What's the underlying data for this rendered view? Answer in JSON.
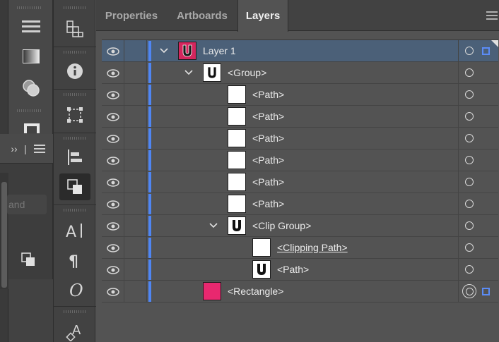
{
  "panel": {
    "tabs": [
      {
        "label": "Properties"
      },
      {
        "label": "Artboards"
      },
      {
        "label": "Layers"
      }
    ]
  },
  "left_panel": {
    "input_partial_text": "and"
  },
  "layers": [
    {
      "name": "Layer 1",
      "thumb": "layer-thumb",
      "selected": true
    },
    {
      "name": "<Group>",
      "thumb": "horseshoe"
    },
    {
      "name": "<Path>",
      "thumb": "white"
    },
    {
      "name": "<Path>",
      "thumb": "white"
    },
    {
      "name": "<Path>",
      "thumb": "white"
    },
    {
      "name": "<Path>",
      "thumb": "white"
    },
    {
      "name": "<Path>",
      "thumb": "white"
    },
    {
      "name": "<Path>",
      "thumb": "white"
    },
    {
      "name": "<Clip Group>",
      "thumb": "horseshoe"
    },
    {
      "name": "<Clipping Path>",
      "thumb": "white",
      "underlined": true
    },
    {
      "name": "<Path>",
      "thumb": "horseshoe"
    },
    {
      "name": "<Rectangle>",
      "thumb": "pink"
    }
  ],
  "colors": {
    "layer_color": "#4f86f4",
    "selection_bg": "#4b6078",
    "rectangle_fill": "#e8286f",
    "layer_thumb_fill": "#d4265e"
  }
}
